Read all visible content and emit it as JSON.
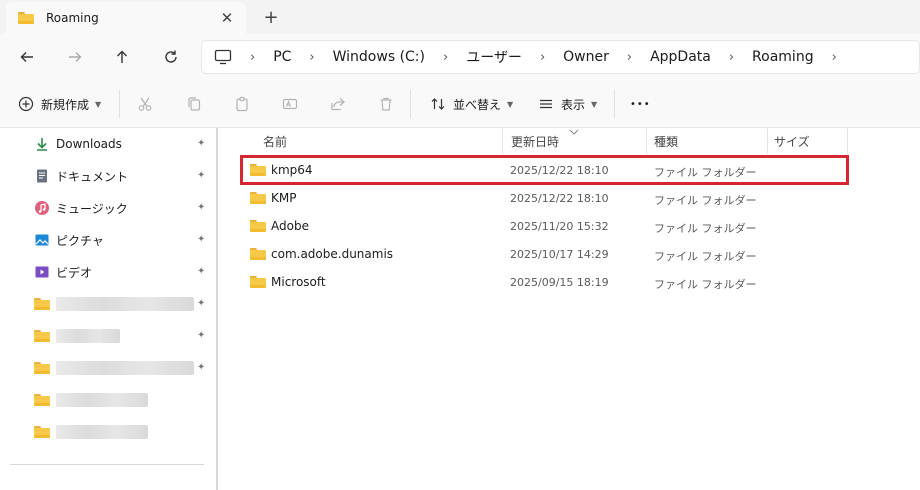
{
  "window": {
    "tab_title": "Roaming",
    "close_glyph": "✕",
    "new_tab_glyph": "+"
  },
  "address": {
    "crumbs": [
      "PC",
      "Windows (C:)",
      "ユーザー",
      "Owner",
      "AppData",
      "Roaming"
    ],
    "separator": "›"
  },
  "toolbar": {
    "new_label": "新規作成",
    "sort_label": "並べ替え",
    "view_label": "表示",
    "more_glyph": "•••"
  },
  "sidebar": {
    "items": [
      {
        "label": "Downloads",
        "icon": "download-icon"
      },
      {
        "label": "ドキュメント",
        "icon": "document-icon"
      },
      {
        "label": "ミュージック",
        "icon": "music-icon"
      },
      {
        "label": "ピクチャ",
        "icon": "pictures-icon"
      },
      {
        "label": "ビデオ",
        "icon": "video-icon"
      }
    ],
    "pin_glyph": "📌"
  },
  "columns": {
    "name": "名前",
    "modified": "更新日時",
    "type": "種類",
    "size": "サイズ"
  },
  "files": [
    {
      "name": "kmp64",
      "modified": "2025/12/22 18:10",
      "type": "ファイル フォルダー"
    },
    {
      "name": "KMP",
      "modified": "2025/12/22 18:10",
      "type": "ファイル フォルダー"
    },
    {
      "name": "Adobe",
      "modified": "2025/11/20 15:32",
      "type": "ファイル フォルダー"
    },
    {
      "name": "com.adobe.dunamis",
      "modified": "2025/10/17 14:29",
      "type": "ファイル フォルダー"
    },
    {
      "name": "Microsoft",
      "modified": "2025/09/15 18:19",
      "type": "ファイル フォルダー"
    }
  ],
  "colors": {
    "highlight": "#d62630",
    "folder": "#f7c948",
    "accent": "#0067c0"
  }
}
